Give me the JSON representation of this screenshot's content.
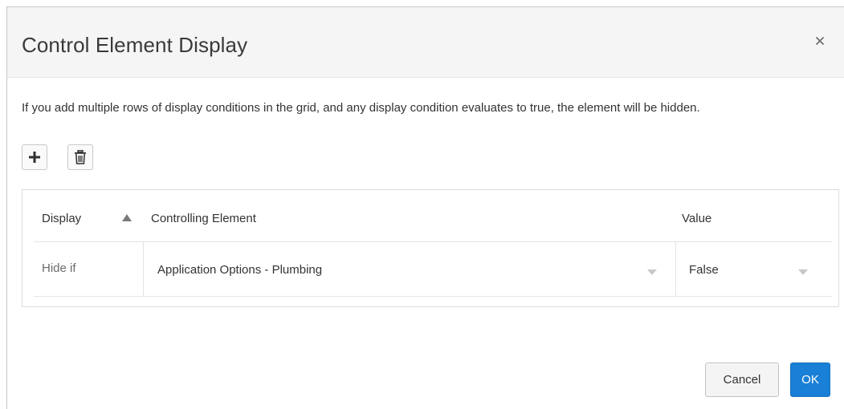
{
  "dialog": {
    "title": "Control Element Display",
    "close_icon": "close-icon",
    "info_text": "If you add multiple rows of display conditions in the grid, and any display condition evaluates to true, the element will be hidden."
  },
  "toolbar": {
    "add_icon": "plus-icon",
    "delete_icon": "trash-icon"
  },
  "grid": {
    "columns": [
      "Display",
      "Controlling Element",
      "Value"
    ],
    "sort_icon": "sort-ascending-icon",
    "rows": [
      {
        "display": "Hide if",
        "controlling_element": "Application Options - Plumbing",
        "value": "False"
      }
    ]
  },
  "footer": {
    "cancel_label": "Cancel",
    "ok_label": "OK"
  },
  "colors": {
    "primary": "#1a7fd6",
    "header_bg": "#f5f5f5"
  }
}
